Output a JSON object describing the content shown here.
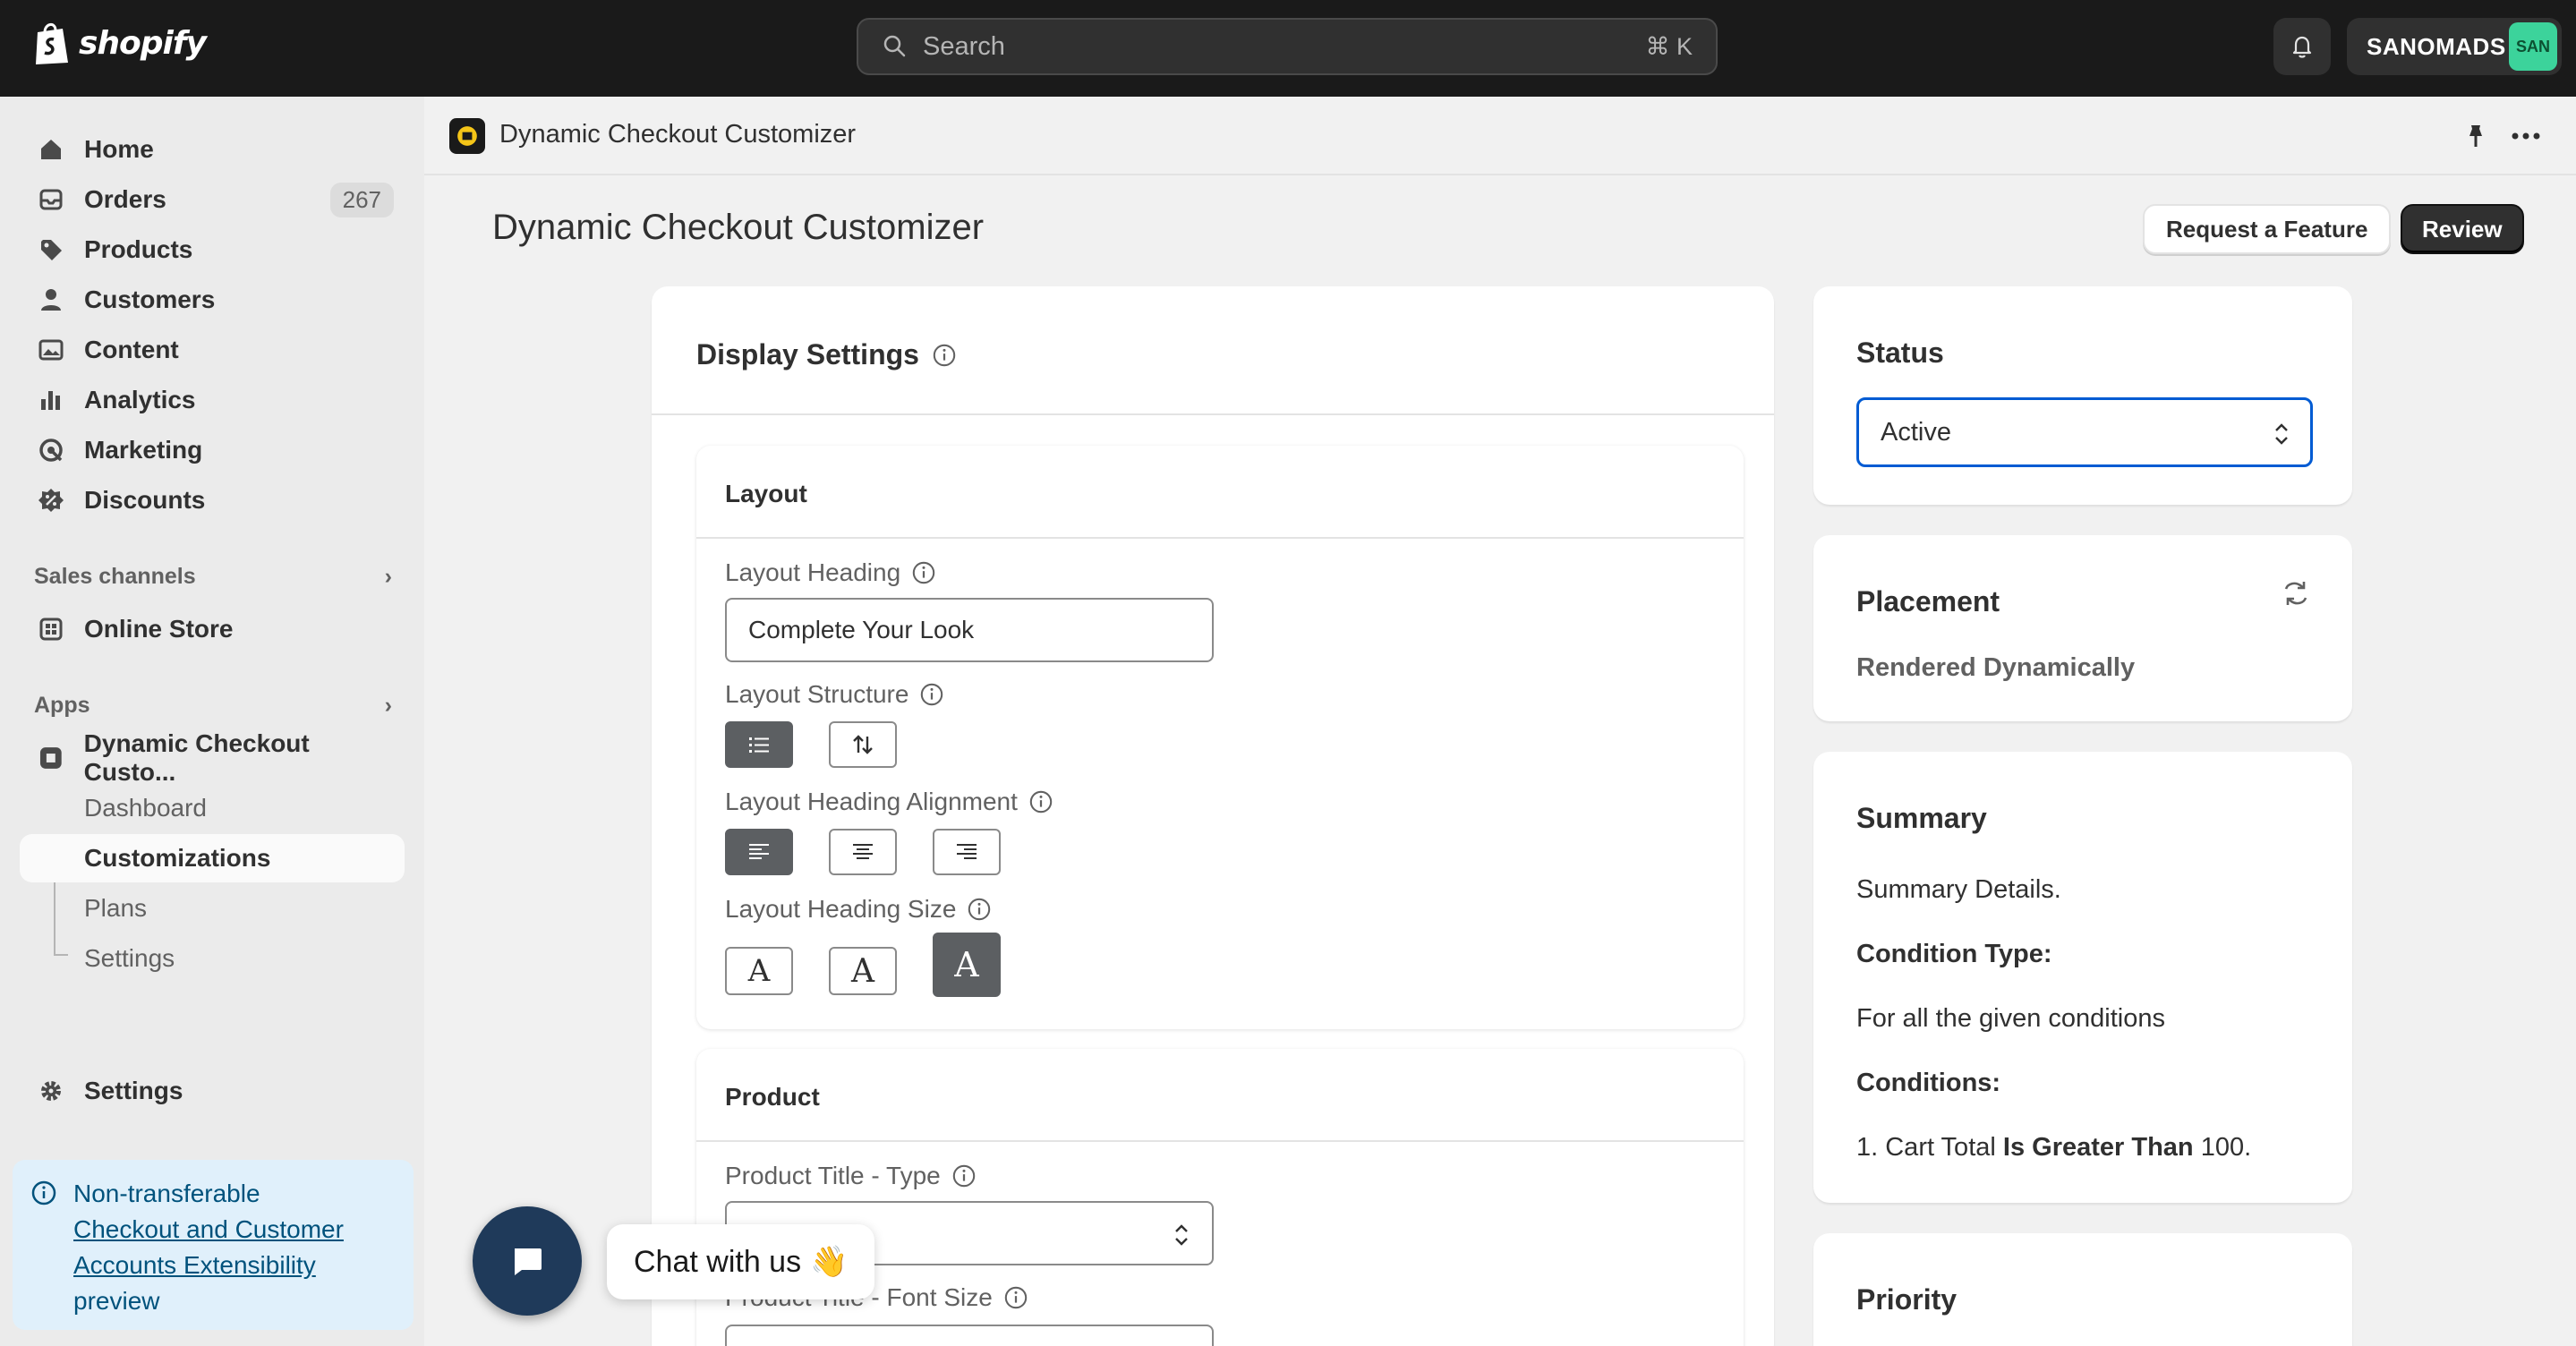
{
  "topbar": {
    "brand": "shopify",
    "search_placeholder": "Search",
    "search_shortcut": "⌘ K",
    "store_name": "SANOMADS",
    "store_initials": "SAN"
  },
  "sidebar": {
    "items": [
      {
        "label": "Home",
        "icon": "home-icon"
      },
      {
        "label": "Orders",
        "icon": "orders-icon",
        "badge": "267"
      },
      {
        "label": "Products",
        "icon": "tag-icon"
      },
      {
        "label": "Customers",
        "icon": "person-icon"
      },
      {
        "label": "Content",
        "icon": "content-icon"
      },
      {
        "label": "Analytics",
        "icon": "bar-chart-icon"
      },
      {
        "label": "Marketing",
        "icon": "target-icon"
      },
      {
        "label": "Discounts",
        "icon": "discount-icon"
      }
    ],
    "sales_channels_label": "Sales channels",
    "online_store": "Online Store",
    "apps_label": "Apps",
    "app_name": "Dynamic Checkout Custo...",
    "app_sub": [
      "Dashboard",
      "Customizations",
      "Plans",
      "Settings"
    ],
    "settings": "Settings",
    "banner_line1": "Non-transferable",
    "banner_link": "Checkout and Customer Accounts Extensibility",
    "banner_line3": "preview"
  },
  "appbar": {
    "title": "Dynamic Checkout Customizer"
  },
  "page": {
    "title": "Dynamic Checkout Customizer",
    "request_feature": "Request a Feature",
    "review": "Review"
  },
  "display_settings": {
    "title": "Display Settings",
    "layout": {
      "title": "Layout",
      "heading_label": "Layout Heading",
      "heading_value": "Complete Your Look",
      "structure_label": "Layout Structure",
      "alignment_label": "Layout Heading Alignment",
      "size_label": "Layout Heading Size",
      "size_glyph": "A"
    },
    "product": {
      "title": "Product",
      "title_type_label": "Product Title - Type",
      "font_size_label": "Product Title - Font Size"
    }
  },
  "status": {
    "title": "Status",
    "value": "Active"
  },
  "placement": {
    "title": "Placement",
    "value": "Rendered Dynamically"
  },
  "summary": {
    "title": "Summary",
    "details": "Summary Details.",
    "condition_type_label": "Condition Type:",
    "condition_type_value": "For all the given conditions",
    "conditions_label": "Conditions:",
    "condition_1_prefix": "1. Cart Total ",
    "condition_1_operator": "Is Greater Than",
    "condition_1_value": " 100."
  },
  "priority": {
    "title": "Priority"
  },
  "chat": {
    "label": "Chat with us",
    "emoji": "👋"
  },
  "colors": {
    "topbar": "#1a1a1a",
    "accent_focus": "#005bd3",
    "chat": "#1f3a5a",
    "banner": "#e0f0fb"
  }
}
